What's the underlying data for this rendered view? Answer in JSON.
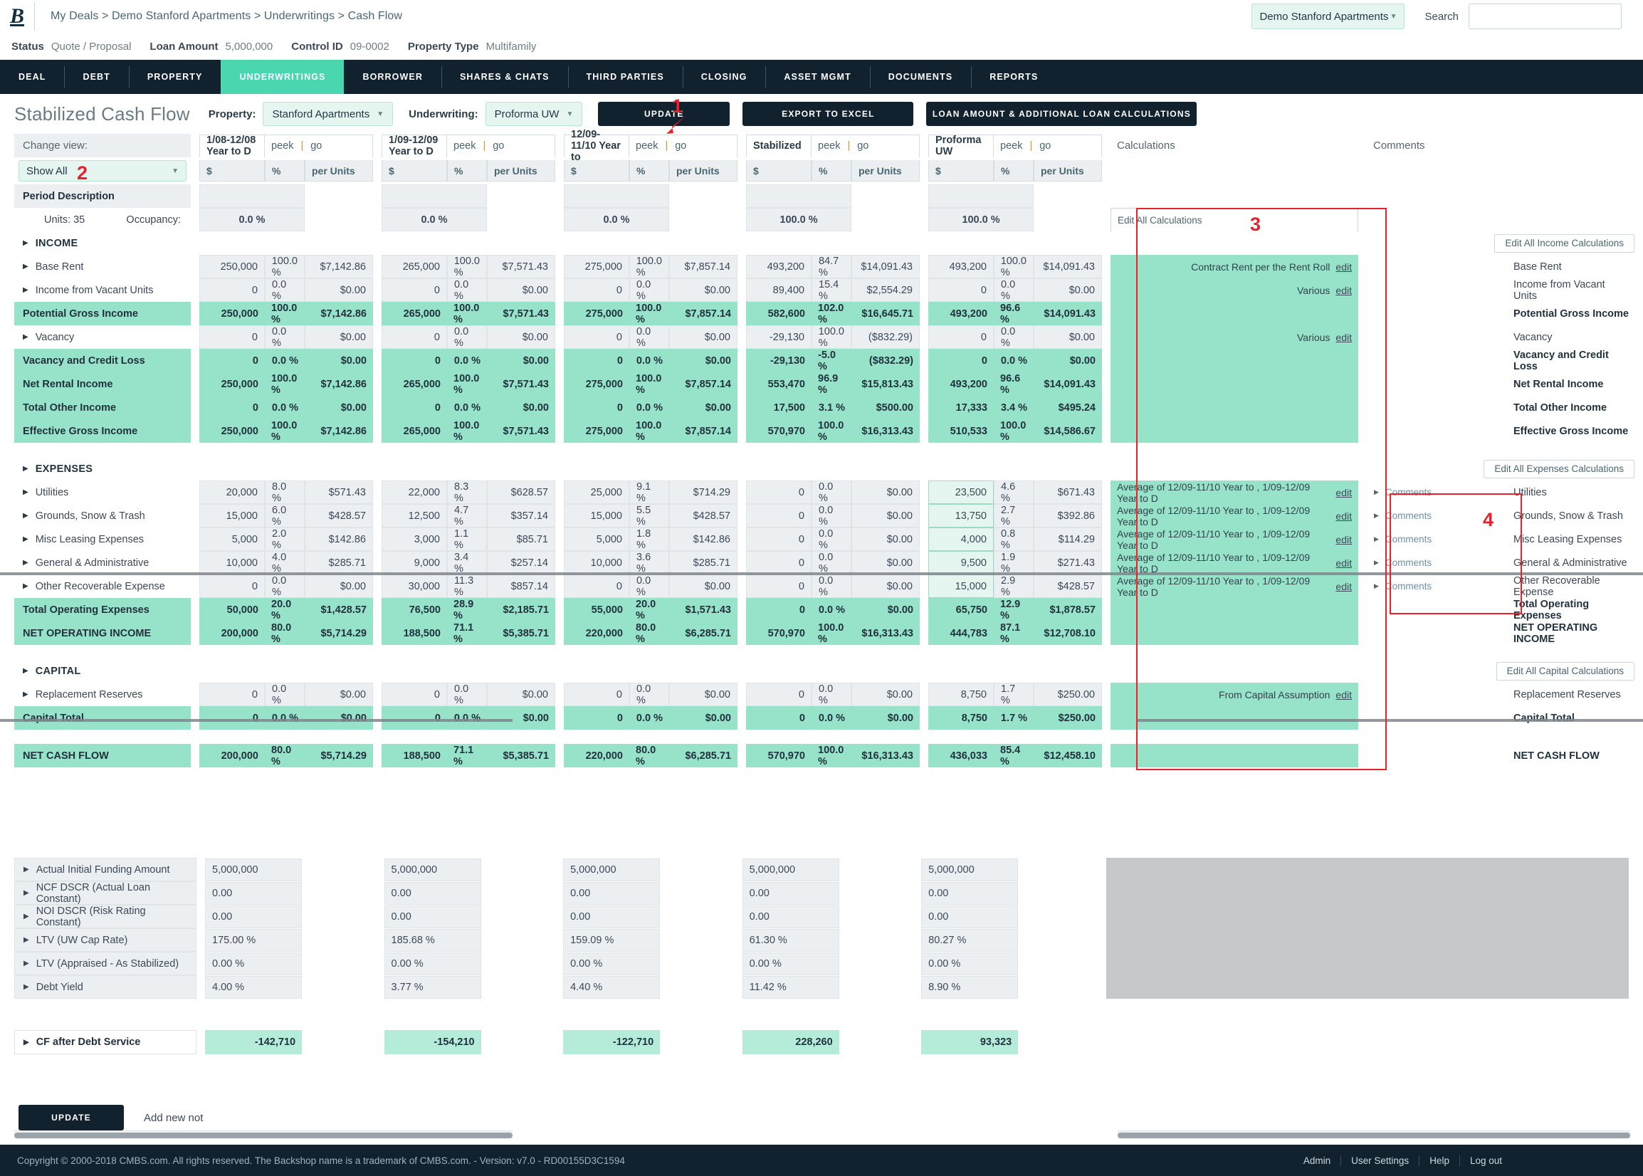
{
  "header": {
    "logo": "B",
    "breadcrumb": "My Deals > Demo Stanford Apartments > Underwritings > Cash Flow",
    "property_selector": "Demo Stanford Apartments",
    "search_label": "Search",
    "search_value": "",
    "search_placeholder": ""
  },
  "status_strip": {
    "status_key": "Status",
    "status_val": "Quote / Proposal",
    "loan_key": "Loan Amount",
    "loan_val": "5,000,000",
    "control_key": "Control ID",
    "control_val": "09-0002",
    "ptype_key": "Property Type",
    "ptype_val": "Multifamily"
  },
  "nav_tabs": [
    {
      "label": "DEAL",
      "active": false
    },
    {
      "label": "DEBT",
      "active": false
    },
    {
      "label": "PROPERTY",
      "active": false
    },
    {
      "label": "UNDERWRITINGS",
      "active": true
    },
    {
      "label": "BORROWER",
      "active": false
    },
    {
      "label": "SHARES & CHATS",
      "active": false
    },
    {
      "label": "THIRD PARTIES",
      "active": false
    },
    {
      "label": "CLOSING",
      "active": false
    },
    {
      "label": "ASSET MGMT",
      "active": false
    },
    {
      "label": "DOCUMENTS",
      "active": false
    },
    {
      "label": "REPORTS",
      "active": false
    }
  ],
  "toolbar": {
    "title": "Stabilized Cash Flow",
    "property_label": "Property:",
    "property_value": "Stanford Apartments",
    "underwriting_label": "Underwriting:",
    "underwriting_value": "Proforma UW",
    "update_btn": "UPDATE",
    "export_btn": "EXPORT TO EXCEL",
    "loan_calc_btn": "LOAN AMOUNT & ADDITIONAL LOAN CALCULATIONS"
  },
  "grid": {
    "change_view_label": "Change view:",
    "change_view_value": "Show All",
    "period_description": "Period Description",
    "units_label": "Units: 35",
    "occupancy_label": "Occupancy:",
    "peek": "peek",
    "go": "go",
    "sub_dollar": "$",
    "sub_pct": "%",
    "sub_unit": "per Units",
    "calculations_header": "Calculations",
    "comments_header": "Comments",
    "edit_all_calculations": "Edit All Calculations",
    "edit_all_income": "Edit All Income Calculations",
    "edit_all_expenses": "Edit All Expenses Calculations",
    "edit_all_capital": "Edit All Capital Calculations",
    "comments_link": "Comments",
    "edit_link": "edit",
    "columns": [
      {
        "title": "1/08-12/08 Year to D"
      },
      {
        "title": "1/09-12/09 Year to D"
      },
      {
        "title": "12/09-11/10 Year to"
      },
      {
        "title": "Stabilized"
      },
      {
        "title": "Proforma UW"
      }
    ],
    "occupancy_row": [
      "0.0 %",
      "0.0 %",
      "0.0 %",
      "100.0 %",
      "100.0 %"
    ],
    "sections": {
      "income": "INCOME",
      "expenses": "EXPENSES",
      "capital": "CAPITAL"
    },
    "rows": [
      {
        "label": "Base Rent",
        "type": "item",
        "cells": [
          [
            "250,000",
            "100.0 %",
            "$7,142.86"
          ],
          [
            "265,000",
            "100.0 %",
            "$7,571.43"
          ],
          [
            "275,000",
            "100.0 %",
            "$7,857.14"
          ],
          [
            "493,200",
            "84.7 %",
            "$14,091.43"
          ],
          [
            "493,200",
            "100.0 %",
            "$14,091.43"
          ]
        ],
        "calc": "Contract Rent per the Rent Roll",
        "calc_edit": "edit",
        "right": "Base Rent"
      },
      {
        "label": "Income from Vacant Units",
        "type": "item",
        "cells": [
          [
            "0",
            "0.0 %",
            "$0.00"
          ],
          [
            "0",
            "0.0 %",
            "$0.00"
          ],
          [
            "0",
            "0.0 %",
            "$0.00"
          ],
          [
            "89,400",
            "15.4 %",
            "$2,554.29"
          ],
          [
            "0",
            "0.0 %",
            "$0.00"
          ]
        ],
        "calc": "Various",
        "calc_edit": "edit",
        "right": "Income from Vacant Units"
      },
      {
        "label": "Potential Gross Income",
        "type": "total",
        "cells": [
          [
            "250,000",
            "100.0 %",
            "$7,142.86"
          ],
          [
            "265,000",
            "100.0 %",
            "$7,571.43"
          ],
          [
            "275,000",
            "100.0 %",
            "$7,857.14"
          ],
          [
            "582,600",
            "102.0 %",
            "$16,645.71"
          ],
          [
            "493,200",
            "96.6 %",
            "$14,091.43"
          ]
        ],
        "calc": "",
        "right": "Potential Gross Income"
      },
      {
        "label": "Vacancy",
        "type": "item",
        "cells": [
          [
            "0",
            "0.0 %",
            "$0.00"
          ],
          [
            "0",
            "0.0 %",
            "$0.00"
          ],
          [
            "0",
            "0.0 %",
            "$0.00"
          ],
          [
            "-29,130",
            "100.0 %",
            "($832.29)"
          ],
          [
            "0",
            "0.0 %",
            "$0.00"
          ]
        ],
        "calc": "Various",
        "calc_edit": "edit",
        "right": "Vacancy"
      },
      {
        "label": "Vacancy and Credit Loss",
        "type": "total",
        "cells": [
          [
            "0",
            "0.0 %",
            "$0.00"
          ],
          [
            "0",
            "0.0 %",
            "$0.00"
          ],
          [
            "0",
            "0.0 %",
            "$0.00"
          ],
          [
            "-29,130",
            "-5.0 %",
            "($832.29)"
          ],
          [
            "0",
            "0.0 %",
            "$0.00"
          ]
        ],
        "calc": "",
        "right": "Vacancy and Credit Loss"
      },
      {
        "label": "Net Rental Income",
        "type": "total",
        "cells": [
          [
            "250,000",
            "100.0 %",
            "$7,142.86"
          ],
          [
            "265,000",
            "100.0 %",
            "$7,571.43"
          ],
          [
            "275,000",
            "100.0 %",
            "$7,857.14"
          ],
          [
            "553,470",
            "96.9 %",
            "$15,813.43"
          ],
          [
            "493,200",
            "96.6 %",
            "$14,091.43"
          ]
        ],
        "calc": "",
        "right": "Net Rental Income"
      },
      {
        "label": "Total Other Income",
        "type": "total",
        "cells": [
          [
            "0",
            "0.0 %",
            "$0.00"
          ],
          [
            "0",
            "0.0 %",
            "$0.00"
          ],
          [
            "0",
            "0.0 %",
            "$0.00"
          ],
          [
            "17,500",
            "3.1 %",
            "$500.00"
          ],
          [
            "17,333",
            "3.4 %",
            "$495.24"
          ]
        ],
        "calc": "",
        "right": "Total Other Income"
      },
      {
        "label": "Effective Gross Income",
        "type": "total",
        "cells": [
          [
            "250,000",
            "100.0 %",
            "$7,142.86"
          ],
          [
            "265,000",
            "100.0 %",
            "$7,571.43"
          ],
          [
            "275,000",
            "100.0 %",
            "$7,857.14"
          ],
          [
            "570,970",
            "100.0 %",
            "$16,313.43"
          ],
          [
            "510,533",
            "100.0 %",
            "$14,586.67"
          ]
        ],
        "calc": "",
        "right": "Effective Gross Income"
      }
    ],
    "expense_rows": [
      {
        "label": "Utilities",
        "cells": [
          [
            "20,000",
            "8.0 %",
            "$571.43"
          ],
          [
            "22,000",
            "8.3 %",
            "$628.57"
          ],
          [
            "25,000",
            "9.1 %",
            "$714.29"
          ],
          [
            "0",
            "0.0 %",
            "$0.00"
          ],
          [
            "23,500",
            "4.6 %",
            "$671.43"
          ]
        ],
        "input_index": 4,
        "calc": "Average of 12/09-11/10 Year to , 1/09-12/09 Year to D",
        "calc_edit": "edit",
        "right": "Utilities"
      },
      {
        "label": "Grounds, Snow & Trash",
        "cells": [
          [
            "15,000",
            "6.0 %",
            "$428.57"
          ],
          [
            "12,500",
            "4.7 %",
            "$357.14"
          ],
          [
            "15,000",
            "5.5 %",
            "$428.57"
          ],
          [
            "0",
            "0.0 %",
            "$0.00"
          ],
          [
            "13,750",
            "2.7 %",
            "$392.86"
          ]
        ],
        "input_index": 4,
        "calc": "Average of 12/09-11/10 Year to , 1/09-12/09 Year to D",
        "calc_edit": "edit",
        "right": "Grounds, Snow & Trash"
      },
      {
        "label": "Misc Leasing Expenses",
        "cells": [
          [
            "5,000",
            "2.0 %",
            "$142.86"
          ],
          [
            "3,000",
            "1.1 %",
            "$85.71"
          ],
          [
            "5,000",
            "1.8 %",
            "$142.86"
          ],
          [
            "0",
            "0.0 %",
            "$0.00"
          ],
          [
            "4,000",
            "0.8 %",
            "$114.29"
          ]
        ],
        "input_index": 4,
        "calc": "Average of 12/09-11/10 Year to , 1/09-12/09 Year to D",
        "calc_edit": "edit",
        "right": "Misc Leasing Expenses"
      },
      {
        "label": "General & Administrative",
        "cells": [
          [
            "10,000",
            "4.0 %",
            "$285.71"
          ],
          [
            "9,000",
            "3.4 %",
            "$257.14"
          ],
          [
            "10,000",
            "3.6 %",
            "$285.71"
          ],
          [
            "0",
            "0.0 %",
            "$0.00"
          ],
          [
            "9,500",
            "1.9 %",
            "$271.43"
          ]
        ],
        "input_index": 4,
        "calc": "Average of 12/09-11/10 Year to , 1/09-12/09 Year to D",
        "calc_edit": "edit",
        "right": "General & Administrative"
      },
      {
        "label": "Other Recoverable Expense",
        "cells": [
          [
            "0",
            "0.0 %",
            "$0.00"
          ],
          [
            "30,000",
            "11.3 %",
            "$857.14"
          ],
          [
            "0",
            "0.0 %",
            "$0.00"
          ],
          [
            "0",
            "0.0 %",
            "$0.00"
          ],
          [
            "15,000",
            "2.9 %",
            "$428.57"
          ]
        ],
        "input_index": 4,
        "calc": "Average of 12/09-11/10 Year to , 1/09-12/09 Year to D",
        "calc_edit": "edit",
        "right": "Other Recoverable Expense"
      }
    ],
    "expense_totals": [
      {
        "label": "Total Operating Expenses",
        "cells": [
          [
            "50,000",
            "20.0 %",
            "$1,428.57"
          ],
          [
            "76,500",
            "28.9 %",
            "$2,185.71"
          ],
          [
            "55,000",
            "20.0 %",
            "$1,571.43"
          ],
          [
            "0",
            "0.0 %",
            "$0.00"
          ],
          [
            "65,750",
            "12.9 %",
            "$1,878.57"
          ]
        ],
        "right": "Total Operating Expenses"
      },
      {
        "label": "NET OPERATING INCOME",
        "cells": [
          [
            "200,000",
            "80.0 %",
            "$5,714.29"
          ],
          [
            "188,500",
            "71.1 %",
            "$5,385.71"
          ],
          [
            "220,000",
            "80.0 %",
            "$6,285.71"
          ],
          [
            "570,970",
            "100.0 %",
            "$16,313.43"
          ],
          [
            "444,783",
            "87.1 %",
            "$12,708.10"
          ]
        ],
        "right": "NET OPERATING INCOME"
      }
    ],
    "capital_rows": [
      {
        "label": "Replacement Reserves",
        "type": "item",
        "cells": [
          [
            "0",
            "0.0 %",
            "$0.00"
          ],
          [
            "0",
            "0.0 %",
            "$0.00"
          ],
          [
            "0",
            "0.0 %",
            "$0.00"
          ],
          [
            "0",
            "0.0 %",
            "$0.00"
          ],
          [
            "8,750",
            "1.7 %",
            "$250.00"
          ]
        ],
        "calc": "From Capital Assumption",
        "calc_edit": "edit",
        "right": "Replacement Reserves"
      },
      {
        "label": "Capital Total",
        "type": "total",
        "cells": [
          [
            "0",
            "0.0 %",
            "$0.00"
          ],
          [
            "0",
            "0.0 %",
            "$0.00"
          ],
          [
            "0",
            "0.0 %",
            "$0.00"
          ],
          [
            "0",
            "0.0 %",
            "$0.00"
          ],
          [
            "8,750",
            "1.7 %",
            "$250.00"
          ]
        ],
        "calc": "",
        "right": "Capital Total"
      }
    ],
    "net_cash_flow": {
      "label": "NET CASH FLOW",
      "cells": [
        [
          "200,000",
          "80.0 %",
          "$5,714.29"
        ],
        [
          "188,500",
          "71.1 %",
          "$5,385.71"
        ],
        [
          "220,000",
          "80.0 %",
          "$6,285.71"
        ],
        [
          "570,970",
          "100.0 %",
          "$16,313.43"
        ],
        [
          "436,033",
          "85.4 %",
          "$12,458.10"
        ]
      ],
      "right": "NET CASH FLOW"
    }
  },
  "metrics": [
    {
      "label": "Actual Initial Funding Amount",
      "values": [
        "5,000,000",
        "5,000,000",
        "5,000,000",
        "5,000,000",
        "5,000,000"
      ]
    },
    {
      "label": "NCF DSCR (Actual Loan Constant)",
      "values": [
        "0.00",
        "0.00",
        "0.00",
        "0.00",
        "0.00"
      ]
    },
    {
      "label": "NOI DSCR (Risk Rating Constant)",
      "values": [
        "0.00",
        "0.00",
        "0.00",
        "0.00",
        "0.00"
      ]
    },
    {
      "label": "LTV (UW Cap Rate)",
      "values": [
        "175.00 %",
        "185.68 %",
        "159.09 %",
        "61.30 %",
        "80.27 %"
      ]
    },
    {
      "label": "LTV (Appraised - As Stabilized)",
      "values": [
        "0.00 %",
        "0.00 %",
        "0.00 %",
        "0.00 %",
        "0.00 %"
      ]
    },
    {
      "label": "Debt Yield",
      "values": [
        "4.00 %",
        "3.77 %",
        "4.40 %",
        "11.42 %",
        "8.90 %"
      ]
    }
  ],
  "cf_after_debt": {
    "label": "CF after Debt Service",
    "values": [
      "-142,710",
      "-154,210",
      "-122,710",
      "228,260",
      "93,323"
    ]
  },
  "bottom": {
    "update_btn": "UPDATE",
    "add_new_note": "Add new not"
  },
  "footer": {
    "copyright": "Copyright © 2000-2018 CMBS.com. All rights reserved. The Backshop name is a trademark of CMBS.com. - Version: v7.0 - RD00155D3C1594",
    "links": [
      "Admin",
      "User Settings",
      "Help",
      "Log out"
    ]
  },
  "annotations": [
    {
      "num": "1"
    },
    {
      "num": "2"
    },
    {
      "num": "3"
    },
    {
      "num": "4"
    }
  ],
  "colors": {
    "navy": "#11212e",
    "mint": "#4ad6ae",
    "mint_row": "#96e3c9",
    "annotation_red": "#e8212b"
  }
}
